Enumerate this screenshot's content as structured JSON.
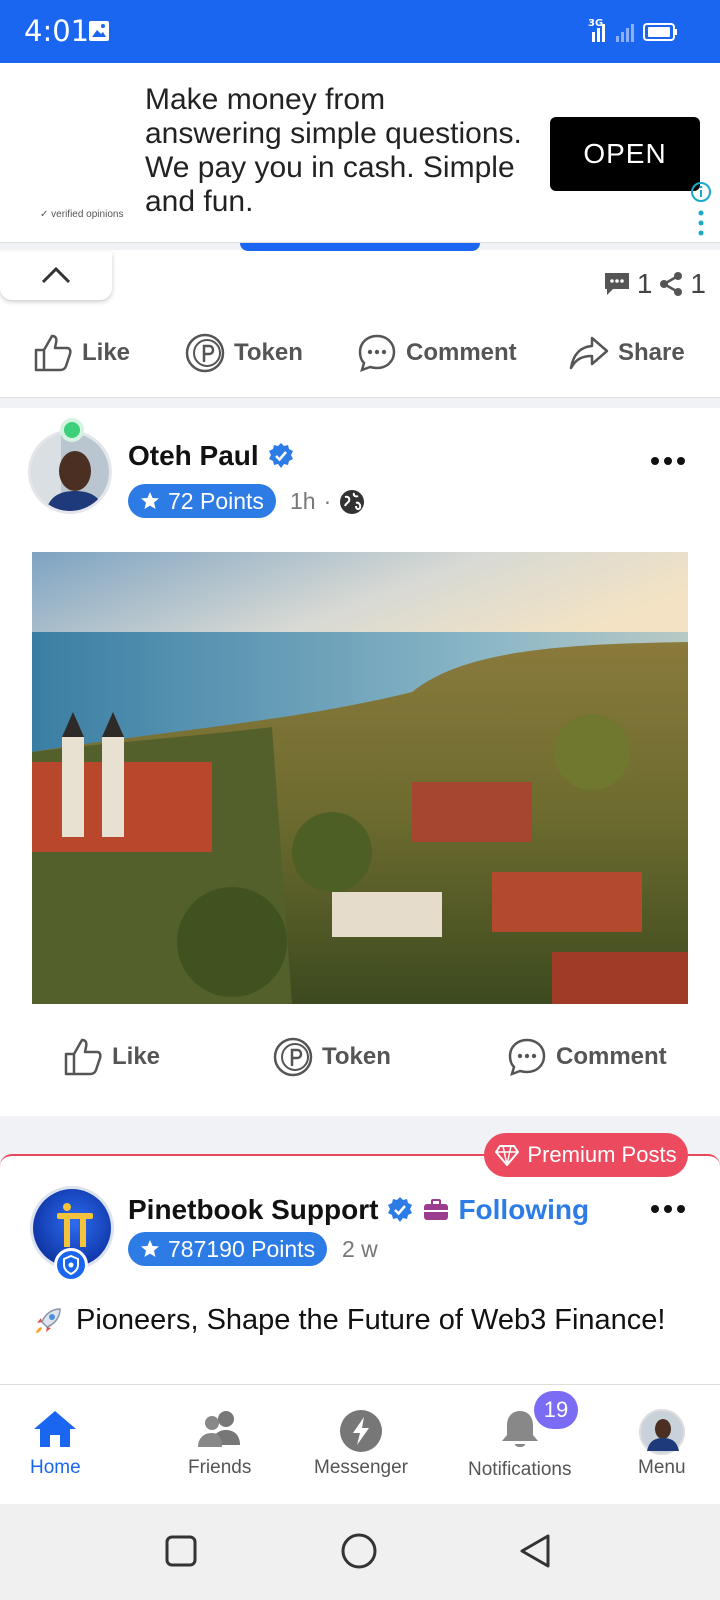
{
  "status_bar": {
    "time": "4:01",
    "network": "3G"
  },
  "ad": {
    "brand": "verified opinions",
    "text": "Make money from answering simple questions. We pay you in cash. Simple and fun.",
    "open_label": "OPEN"
  },
  "prev_post": {
    "comments_count": "1",
    "shares_count": "1",
    "actions": {
      "like": "Like",
      "token": "Token",
      "comment": "Comment",
      "share": "Share"
    }
  },
  "post1": {
    "author": "Oteh Paul",
    "points": "72 Points",
    "time": "1h",
    "actions": {
      "like": "Like",
      "token": "Token",
      "comment": "Comment"
    }
  },
  "post2": {
    "premium_label": "Premium Posts",
    "author": "Pinetbook Support",
    "following": "Following",
    "points": "787190 Points",
    "time": "2 w",
    "text": "Pioneers, Shape the Future of Web3 Finance!"
  },
  "bottom_nav": {
    "home": "Home",
    "friends": "Friends",
    "messenger": "Messenger",
    "notifications": "Notifications",
    "notifications_badge": "19",
    "menu": "Menu"
  },
  "colors": {
    "primary": "#1a66f0",
    "points_badge": "#2d7be5",
    "premium": "#ec4a5e",
    "online": "#3ecf7a"
  }
}
